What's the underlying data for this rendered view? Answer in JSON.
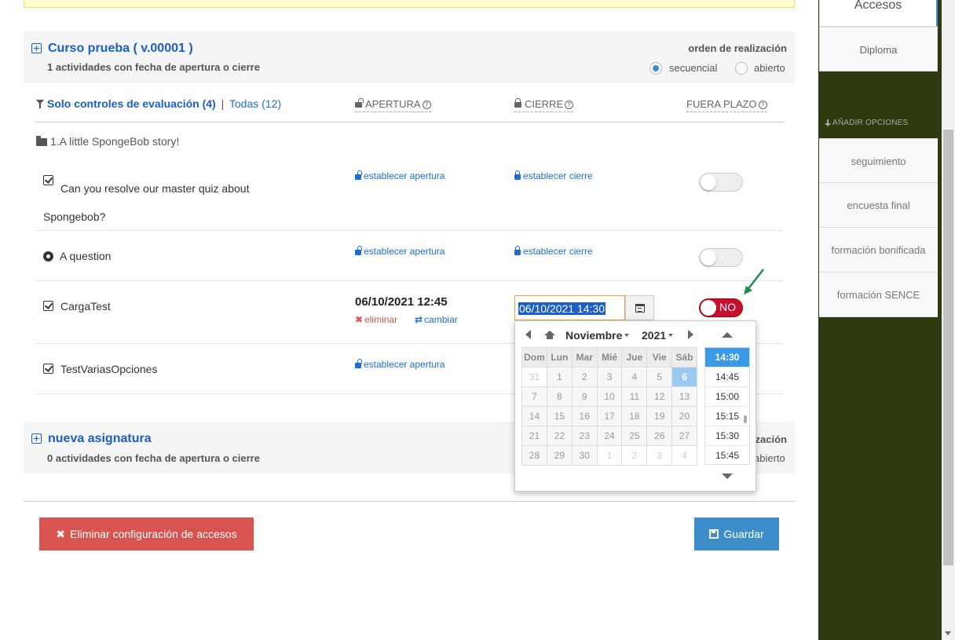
{
  "section1": {
    "title": "Curso prueba ( v.00001 )",
    "subtitle": "1 actividades con fecha de apertura o cierre",
    "order_title": "orden de realización",
    "order_options": [
      "secuencial",
      "abierto"
    ],
    "order_selected": "secuencial"
  },
  "filters": {
    "eval_label": "Solo controles de evaluación (4)",
    "separator": "|",
    "all_label": "Todas (12)"
  },
  "columns": {
    "apertura": "APERTURA",
    "cierre": "CIERRE",
    "fuera_plazo": "FUERA PLAZO",
    "help": "?"
  },
  "folder": {
    "label": "1.A little SpongeBob story!"
  },
  "rows": [
    {
      "name": "Can you resolve our master quiz about Spongebob?",
      "apertura_link": "establecer apertura",
      "cierre_link": "establecer cierre",
      "toggle": "NO"
    },
    {
      "name": "A question",
      "apertura_link": "establecer apertura",
      "cierre_link": "establecer cierre",
      "toggle": "NO"
    },
    {
      "name": "CargaTest",
      "apertura_date": "06/10/2021 12:45",
      "delete_link": "eliminar",
      "change_link": "cambiar",
      "cierre_value": "06/10/2021 14:30",
      "toggle": "NO"
    },
    {
      "name": "TestVariasOpciones",
      "apertura_link": "establecer apertura"
    }
  ],
  "picker": {
    "month": "Noviembre",
    "year": "2021",
    "weekdays": [
      "Dom",
      "Lun",
      "Mar",
      "Mié",
      "Jue",
      "Vie",
      "Sáb"
    ],
    "weeks": [
      [
        "31",
        "1",
        "2",
        "3",
        "4",
        "5",
        "6"
      ],
      [
        "7",
        "8",
        "9",
        "10",
        "11",
        "12",
        "13"
      ],
      [
        "14",
        "15",
        "16",
        "17",
        "18",
        "19",
        "20"
      ],
      [
        "21",
        "22",
        "23",
        "24",
        "25",
        "26",
        "27"
      ],
      [
        "28",
        "29",
        "30",
        "1",
        "2",
        "3",
        "4"
      ]
    ],
    "selected_day": "6",
    "times": [
      "14:30",
      "14:45",
      "15:00",
      "15:15",
      "15:30",
      "15:45"
    ],
    "selected_time": "14:30"
  },
  "section2": {
    "title": "nueva asignatura",
    "subtitle": "0 actividades con fecha de apertura o cierre",
    "order_title_partial": "zación",
    "order_option_partial": "abierto"
  },
  "buttons": {
    "delete": "Eliminar configuración de accesos",
    "save": "Guardar"
  },
  "sidebar": {
    "active_tab": "Accesos",
    "tab2": "Diploma",
    "add_options": "AÑADIR OPCIONES",
    "items": [
      "seguimiento",
      "encuesta final",
      "formación bonificada",
      "formación SENCE"
    ]
  },
  "colors": {
    "link_blue": "#1a6fd1",
    "danger": "#d9534f",
    "primary": "#3c8dca",
    "toggle_red": "#c8102e",
    "sidebar_bg": "#2f3a0e",
    "arrow_green": "#1e8a4c"
  },
  "icons": [
    "plus-square-icon",
    "filter-icon",
    "unlock-icon",
    "lock-icon",
    "help-icon",
    "folder-icon",
    "check-square-icon",
    "gear-icon",
    "calendar-icon",
    "home-icon",
    "save-icon",
    "times-icon",
    "exchange-icon",
    "arrow-down-icon"
  ]
}
